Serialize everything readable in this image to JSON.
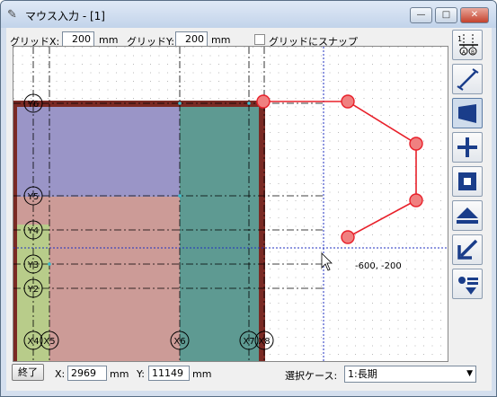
{
  "window": {
    "title": "マウス入力 - [1]",
    "buttons": {
      "minimize": "—",
      "maximize": "□",
      "close": "✕"
    }
  },
  "toolbar": {
    "gridx_label": "グリッドX:",
    "gridx_value": "200",
    "gridx_unit": "mm",
    "gridy_label": "グリッドY:",
    "gridy_value": "200",
    "gridy_unit": "mm",
    "snap_label": "グリッドにスナップ",
    "snap_checked": false
  },
  "canvas": {
    "axis_labels": [
      "Y6",
      "Y5",
      "Y4",
      "Y3",
      "Y2",
      "X4",
      "X5",
      "X6",
      "X7",
      "X8"
    ],
    "cursor_readout": "-600, -200",
    "polyline_color": "#e8202a",
    "fill_colors": {
      "purple": "#9a95c7",
      "pink": "#cc9b97",
      "teal": "#5e9a92",
      "green": "#b8cc8a",
      "wall": "#7a2a24"
    }
  },
  "sidebar": {
    "tools": [
      {
        "icon": "axis-ab-icon",
        "selected": false
      },
      {
        "icon": "line-icon",
        "selected": false
      },
      {
        "icon": "polygon-icon",
        "selected": true
      },
      {
        "icon": "cross-icon",
        "selected": false
      },
      {
        "icon": "square-icon",
        "selected": false
      },
      {
        "icon": "eject-icon",
        "selected": false
      },
      {
        "icon": "arrow-down-left-icon",
        "selected": false
      },
      {
        "icon": "list-down-icon",
        "selected": false
      }
    ]
  },
  "footer": {
    "end_button": "終了",
    "x_label": "X:",
    "x_value": "2969",
    "x_unit": "mm",
    "y_label": "Y:",
    "y_value": "11149",
    "y_unit": "mm",
    "case_label": "選択ケース:",
    "case_value": "1:長期"
  }
}
